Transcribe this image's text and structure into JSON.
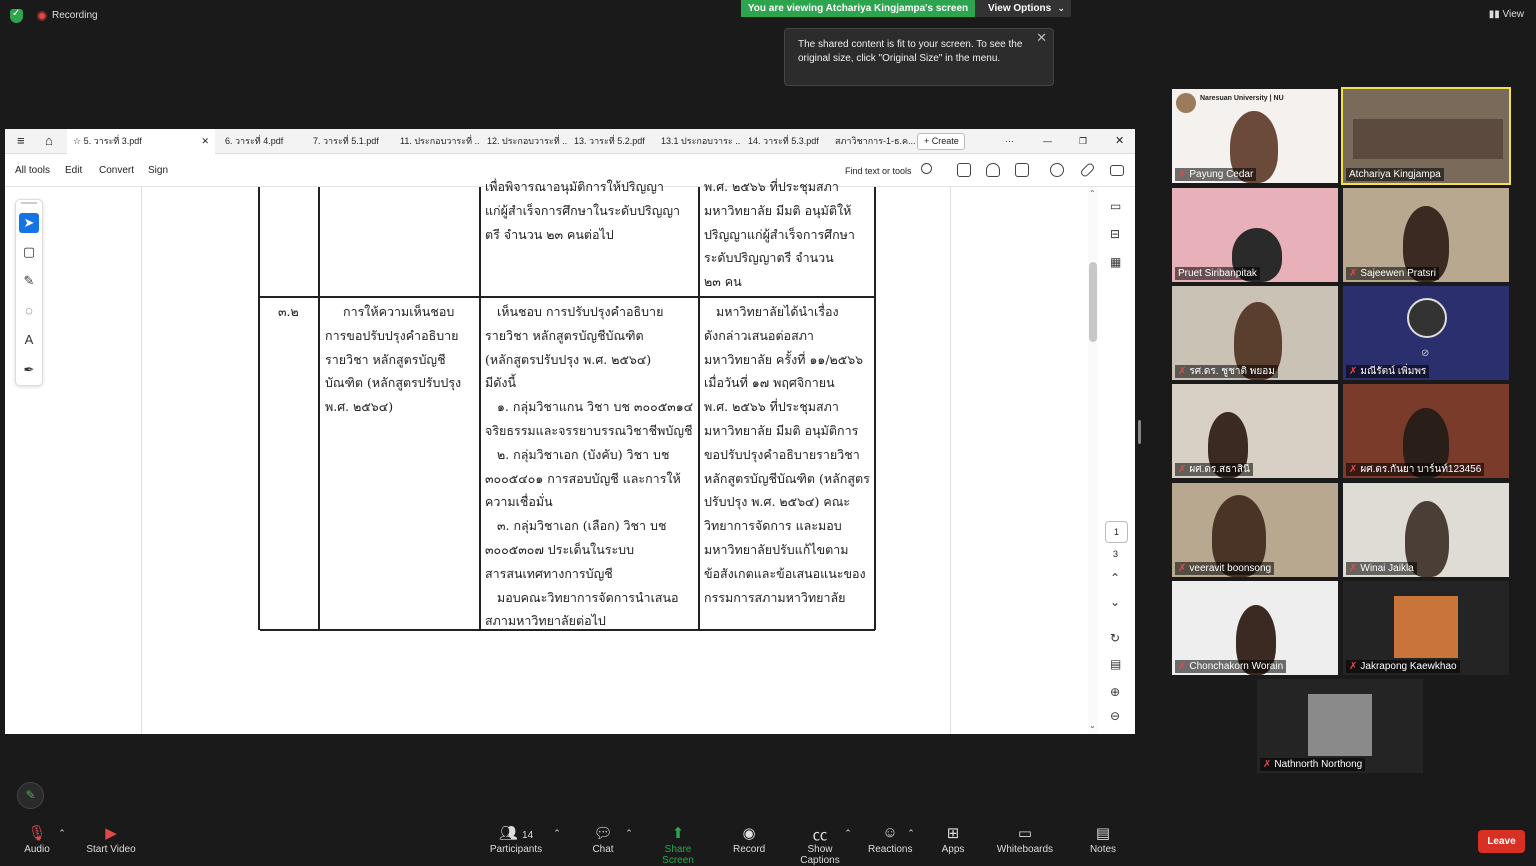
{
  "topbar": {
    "recording_label": "Recording",
    "share_banner": "You are viewing Atchariya Kingjampa's screen",
    "view_options": "View Options",
    "view_label": "View"
  },
  "tooltip": {
    "line1": "The shared content is fit to your screen. To see the",
    "line2": "original size, click \"Original Size\" in the menu."
  },
  "viewer": {
    "tabs": [
      "5. วาระที่ 3.pdf",
      "6. วาระที่ 4.pdf",
      "7. วาระที่ 5.1.pdf",
      "11. ประกอบวาระที่ ...",
      "12. ประกอบวาระที่ ...",
      "13. วาระที่ 5.2.pdf",
      "13.1 ประกอบวาระ ...",
      "14. วาระที่ 5.3.pdf",
      "สภาวิชาการ-1-ธ.ค..."
    ],
    "create_label": "Create",
    "menu": [
      "All tools",
      "Edit",
      "Convert",
      "Sign"
    ],
    "find_label": "Find text or tools",
    "page_current": "1",
    "page_total": "3"
  },
  "document": {
    "top_col3": [
      "เพื่อพิจารณาอนุมัติการให้ปริญญา",
      "แก่ผู้สำเร็จการศึกษาในระดับปริญญา",
      "ตรี จำนวน ๒๓ คนต่อไป"
    ],
    "top_col4": [
      "พ.ศ. ๒๕๖๖ ที่ประชุมสภา",
      "มหาวิทยาลัย มีมติ อนุมัติให้",
      "ปริญญาแก่ผู้สำเร็จการศึกษา",
      "ระดับปริญญาตรี จำนวน",
      "๒๓ คน"
    ],
    "row_no": "๓.๒",
    "col2": [
      "การให้ความเห็นชอบ",
      "การขอปรับปรุงคำอธิบาย",
      "รายวิชา หลักสูตรบัญชี",
      "บัณฑิต (หลักสูตรปรับปรุง",
      "พ.ศ. ๒๕๖๔)"
    ],
    "col3": [
      "เห็นชอบ การปรับปรุงคำอธิบาย",
      "รายวิชา หลักสูตรบัญชีบัณฑิต",
      "(หลักสูตรปรับปรุง พ.ศ. ๒๕๖๔)",
      "มีดังนี้",
      "๑. กลุ่มวิชาแกน วิชา บช ๓๐๐๕๓๑๔",
      "จริยธรรมและจรรยาบรรณวิชาชีพบัญชี",
      "๒. กลุ่มวิชาเอก (บังคับ) วิชา บช",
      "๓๐๐๕๔๐๑ การสอบบัญชี และการให้",
      "ความเชื่อมั่น",
      "๓. กลุ่มวิชาเอก (เลือก) วิชา บช",
      "๓๐๐๕๓๐๗ ประเด็นในระบบ",
      "สารสนเทศทางการบัญชี",
      "มอบคณะวิทยาการจัดการนำเสนอ",
      "สภามหาวิทยาลัยต่อไป"
    ],
    "col4": [
      "มหาวิทยาลัยได้นำเรื่อง",
      "ดังกล่าวเสนอต่อสภา",
      "มหาวิทยาลัย ครั้งที่ ๑๑/๒๕๖๖",
      "เมื่อวันที่ ๑๗ พฤศจิกายน",
      "พ.ศ. ๒๕๖๖ ที่ประชุมสภา",
      "มหาวิทยาลัย มีมติ อนุมัติการ",
      "ขอปรับปรุงคำอธิบายรายวิชา",
      "หลักสูตรบัญชีบัณฑิต (หลักสูตร",
      "ปรับปรุง พ.ศ. ๒๕๖๔) คณะ",
      "วิทยาการจัดการ และมอบ",
      "มหาวิทยาลัยปรับแก้ไขตาม",
      "ข้อสังเกตและข้อเสนอแนะของ",
      "กรรมการสภามหาวิทยาลัย"
    ]
  },
  "participants": [
    {
      "name": "Payung Cedar",
      "header": "Naresuan University | NU"
    },
    {
      "name": "Atchariya Kingjampa"
    },
    {
      "name": "Pruet Siribanpitak"
    },
    {
      "name": "Sajeewen Pratsri"
    },
    {
      "name": "รศ.ดร. ชูชาติ พยอม"
    },
    {
      "name": "มณีรัตน์ เพิ่มพร"
    },
    {
      "name": "ผศ.ดร.สธาสินี"
    },
    {
      "name": "ผศ.ดร.กันยา บาร์นท์123456"
    },
    {
      "name": "veeravit boonsong"
    },
    {
      "name": "Winai Jaikla"
    },
    {
      "name": "Chonchakorn Worain"
    },
    {
      "name": "Jakrapong Kaewkhao"
    },
    {
      "name": "Nathnorth Northong"
    }
  ],
  "bottom": {
    "audio": "Audio",
    "start_video": "Start Video",
    "participants": "Participants",
    "participants_count": "14",
    "chat": "Chat",
    "share_screen": "Share Screen",
    "record": "Record",
    "captions": "Show Captions",
    "reactions": "Reactions",
    "apps": "Apps",
    "whiteboards": "Whiteboards",
    "notes": "Notes",
    "leave": "Leave"
  },
  "colors": {
    "share_green": "#2da44e",
    "active_speaker": "#f4e04d",
    "leave_red": "#d93025"
  }
}
